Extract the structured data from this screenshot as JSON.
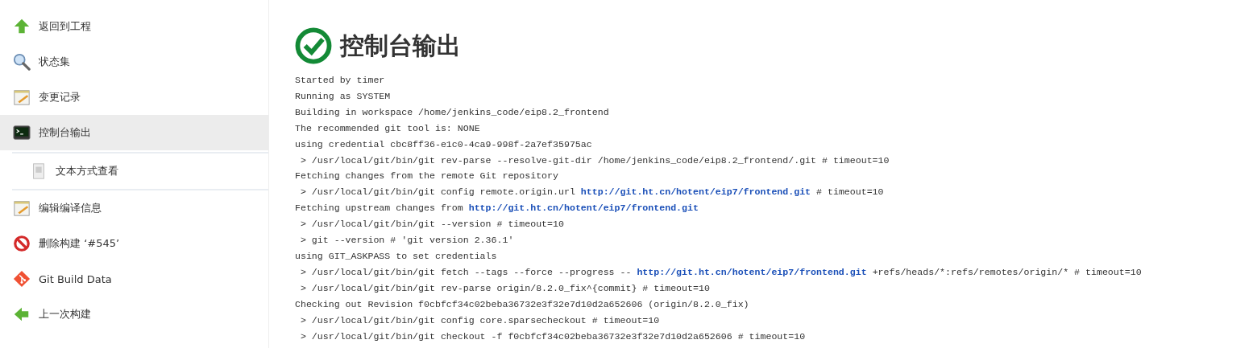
{
  "sidebar": {
    "items": [
      {
        "label": "返回到工程",
        "kind": "up-arrow",
        "selected": false
      },
      {
        "label": "状态集",
        "kind": "magnifier",
        "selected": false
      },
      {
        "label": "变更记录",
        "kind": "notepad",
        "selected": false
      },
      {
        "label": "控制台输出",
        "kind": "terminal",
        "selected": true,
        "children": [
          {
            "label": "文本方式查看",
            "kind": "document",
            "selected": false
          }
        ]
      },
      {
        "label": "编辑编译信息",
        "kind": "notepad",
        "selected": false
      },
      {
        "label": "删除构建 ‘#545’",
        "kind": "no-entry",
        "selected": false
      },
      {
        "label": "Git Build Data",
        "kind": "git",
        "selected": false
      },
      {
        "label": "上一次构建",
        "kind": "left-arrow",
        "selected": false
      }
    ]
  },
  "page": {
    "title": "控制台输出"
  },
  "console": {
    "lines": [
      [
        {
          "kind": "text",
          "text": "Started by timer"
        }
      ],
      [
        {
          "kind": "text",
          "text": "Running as SYSTEM"
        }
      ],
      [
        {
          "kind": "text",
          "text": "Building in workspace /home/jenkins_code/eip8.2_frontend"
        }
      ],
      [
        {
          "kind": "text",
          "text": "The recommended git tool is: NONE"
        }
      ],
      [
        {
          "kind": "text",
          "text": "using credential cbc8ff36-e1c0-4ca9-998f-2a7ef35975ac"
        }
      ],
      [
        {
          "kind": "text",
          "text": " > /usr/local/git/bin/git rev-parse --resolve-git-dir /home/jenkins_code/eip8.2_frontend/.git # timeout=10"
        }
      ],
      [
        {
          "kind": "text",
          "text": "Fetching changes from the remote Git repository"
        }
      ],
      [
        {
          "kind": "text",
          "text": " > /usr/local/git/bin/git config remote.origin.url "
        },
        {
          "kind": "link",
          "text": "http://git.ht.cn/hotent/eip7/frontend.git"
        },
        {
          "kind": "text",
          "text": " # timeout=10"
        }
      ],
      [
        {
          "kind": "text",
          "text": "Fetching upstream changes from "
        },
        {
          "kind": "link",
          "text": "http://git.ht.cn/hotent/eip7/frontend.git"
        }
      ],
      [
        {
          "kind": "text",
          "text": " > /usr/local/git/bin/git --version # timeout=10"
        }
      ],
      [
        {
          "kind": "text",
          "text": " > git --version # 'git version 2.36.1'"
        }
      ],
      [
        {
          "kind": "text",
          "text": "using GIT_ASKPASS to set credentials"
        }
      ],
      [
        {
          "kind": "text",
          "text": " > /usr/local/git/bin/git fetch --tags --force --progress -- "
        },
        {
          "kind": "link",
          "text": "http://git.ht.cn/hotent/eip7/frontend.git"
        },
        {
          "kind": "text",
          "text": " +refs/heads/*:refs/remotes/origin/* # timeout=10"
        }
      ],
      [
        {
          "kind": "text",
          "text": " > /usr/local/git/bin/git rev-parse origin/8.2.0_fix^{commit} # timeout=10"
        }
      ],
      [
        {
          "kind": "text",
          "text": "Checking out Revision f0cbfcf34c02beba36732e3f32e7d10d2a652606 (origin/8.2.0_fix)"
        }
      ],
      [
        {
          "kind": "text",
          "text": " > /usr/local/git/bin/git config core.sparsecheckout # timeout=10"
        }
      ],
      [
        {
          "kind": "text",
          "text": " > /usr/local/git/bin/git checkout -f f0cbfcf34c02beba36732e3f32e7d10d2a652606 # timeout=10"
        }
      ]
    ]
  }
}
